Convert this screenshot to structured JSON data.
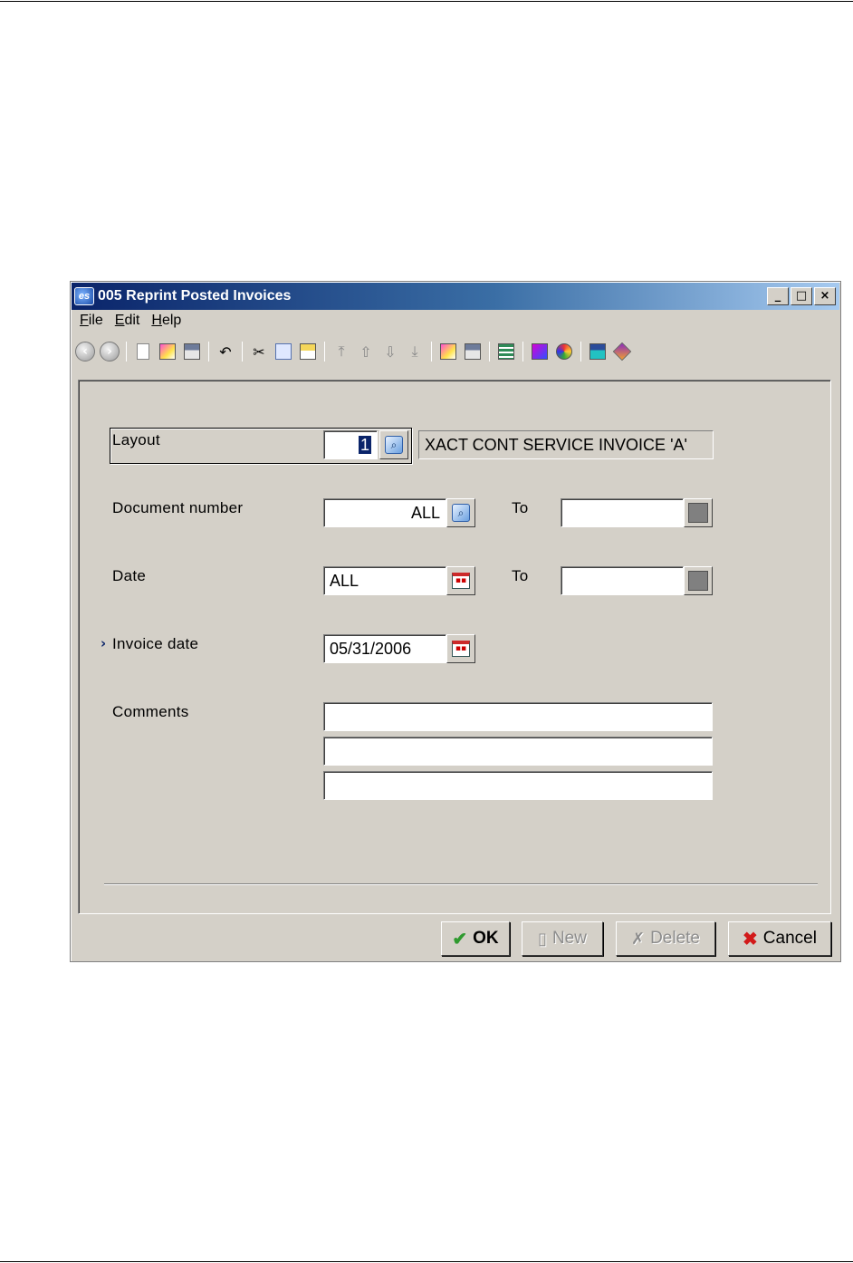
{
  "window": {
    "title": "005 Reprint Posted Invoices",
    "app_icon_text": "es",
    "controls": {
      "minimize": "_",
      "maximize": "□",
      "close": "×"
    }
  },
  "menu": [
    {
      "underlined": "F",
      "rest": "ile"
    },
    {
      "underlined": "E",
      "rest": "dit"
    },
    {
      "underlined": "H",
      "rest": "elp"
    }
  ],
  "toolbar": {
    "icons": [
      "back-icon",
      "forward-icon",
      "new-doc-icon",
      "open-icon",
      "save-icon",
      "undo-icon",
      "cut-icon",
      "copy-icon",
      "paste-icon",
      "first-record-icon",
      "previous-record-icon",
      "next-record-icon",
      "last-record-icon",
      "open-folder-icon",
      "save-disk-icon",
      "list-icon",
      "notes-icon",
      "tools-icon",
      "calculator-icon",
      "book-icon"
    ]
  },
  "form": {
    "layout": {
      "label": "Layout",
      "value": "1",
      "description": "XACT CONT SERVICE INVOICE 'A'"
    },
    "document_number": {
      "label": "Document number",
      "value": "ALL",
      "to_label": "To",
      "to_value": ""
    },
    "date": {
      "label": "Date",
      "value": "ALL",
      "to_label": "To",
      "to_value": ""
    },
    "invoice_date": {
      "marker": "›",
      "label": "Invoice date",
      "value": "05/31/2006"
    },
    "comments": {
      "label": "Comments",
      "lines": [
        "",
        "",
        ""
      ]
    }
  },
  "buttons": {
    "ok": "OK",
    "new": "New",
    "delete": "Delete",
    "cancel": "Cancel"
  }
}
